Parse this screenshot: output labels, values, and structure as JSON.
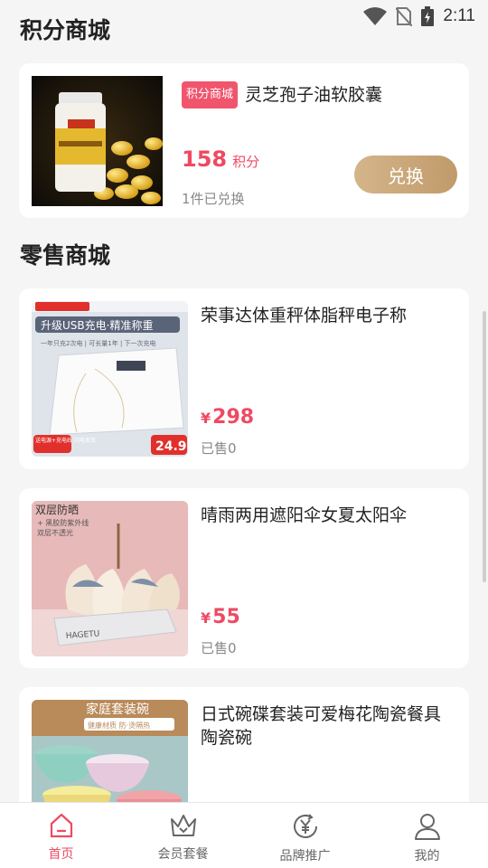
{
  "status": {
    "time": "2:11"
  },
  "points_mall": {
    "title": "积分商城",
    "product": {
      "badge": "积分商城",
      "name": "灵芝孢子油软胶囊",
      "points": "158",
      "points_unit": "积分",
      "redeemed": "1件已兑换",
      "button": "兑换"
    }
  },
  "retail_mall": {
    "title": "零售商城",
    "products": [
      {
        "name": "荣事达体重秤体脂秤电子称",
        "currency": "¥",
        "price": "298",
        "sold": "已售0",
        "image_text": {
          "header": "升级USB充电·精准称重",
          "sub": "一年只充2次电  |  可长量1年  |  下一次充电  ",
          "price_tag": "24.9",
          "corner": "送电源+充电线 闪电发货"
        }
      },
      {
        "name": "晴雨两用遮阳伞女夏太阳伞",
        "currency": "¥",
        "price": "55",
        "sold": "已售0",
        "image_text": {
          "header": "双层防晒",
          "sub1": "+ 黑胶防紫外线",
          "sub2": "双层不透光",
          "brand": "HAGETU"
        }
      },
      {
        "name": "日式碗碟套装可爱梅花陶瓷餐具陶瓷碗",
        "image_text": {
          "header": "家庭套装碗",
          "sub": "健康材质  防·烫隔热"
        }
      }
    ]
  },
  "tabbar": {
    "items": [
      {
        "label": "首页",
        "icon": "home-icon",
        "active": true
      },
      {
        "label": "会员套餐",
        "icon": "crown-icon",
        "active": false
      },
      {
        "label": "品牌推广",
        "icon": "yen-refresh-icon",
        "active": false
      },
      {
        "label": "我的",
        "icon": "user-icon",
        "active": false
      }
    ]
  },
  "colors": {
    "accent": "#ee4a62",
    "button_gold": "#c9a777",
    "background": "#f5f5f5"
  }
}
